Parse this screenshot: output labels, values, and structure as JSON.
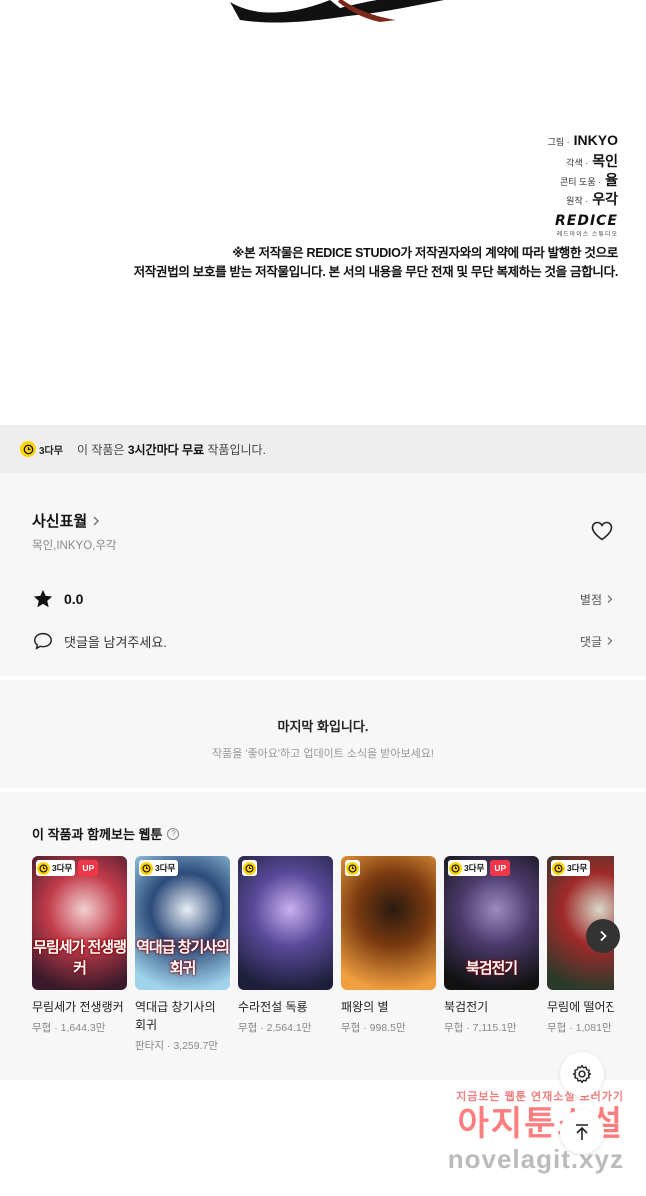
{
  "comic": {
    "credits": [
      {
        "role": "그림 ·",
        "name": "INKYO"
      },
      {
        "role": "각색 ·",
        "name": "목인"
      },
      {
        "role": "콘티 도움 ·",
        "name": "율"
      },
      {
        "role": "원작 ·",
        "name": "우각"
      }
    ],
    "logo_mark": "REDICE",
    "logo_sub": "레드아이스 스튜디오",
    "notice_line1": "※본 저작물은 REDICE STUDIO가 저작권자와의 계약에 따라 발행한 것으로",
    "notice_line2": "저작권법의 보호를 받는 저작물입니다. 본 서의 내용을 무단 전재 및 무단 복제하는 것을 금합니다."
  },
  "free_bar": {
    "badge": "3다무",
    "text_prefix": "이 작품은 ",
    "text_bold": "3시간마다 무료",
    "text_suffix": " 작품입니다."
  },
  "series": {
    "title": "사신표월",
    "authors": "목인,INKYO,우각",
    "rating": "0.0",
    "rating_link": "별점",
    "comment_prompt": "댓글을 남겨주세요.",
    "comment_link": "댓글"
  },
  "last_episode": {
    "title": "마지막 화입니다.",
    "subtitle": "작품을 '좋아요'하고 업데이트 소식을 받아보세요!"
  },
  "recommendations": {
    "title": "이 작품과 함께보는 웹툰",
    "wait_label": "3다무",
    "up_label": "UP",
    "items": [
      {
        "title": "무림세가 전생랭커",
        "genre": "무협",
        "views": "1,644.3만",
        "wait": true,
        "up": true,
        "cover_text": "무림세가 전생랭커",
        "colors": [
          "#3a1a2a",
          "#c23b4a",
          "#f2d0d0"
        ]
      },
      {
        "title": "역대급 창기사의 회귀",
        "genre": "판타지",
        "views": "3,259.7만",
        "wait": true,
        "up": false,
        "cover_text": "역대급 창기사의 회귀",
        "colors": [
          "#9fd3ea",
          "#2c4a7a",
          "#e8eef5"
        ]
      },
      {
        "title": "수라전설 독룡",
        "genre": "무협",
        "views": "2,564.1만",
        "wait": false,
        "up": false,
        "cover_text": "",
        "colors": [
          "#1d1f3a",
          "#5a4a9a",
          "#c8b0f0"
        ]
      },
      {
        "title": "패왕의 별",
        "genre": "무협",
        "views": "998.5만",
        "wait": false,
        "up": false,
        "cover_text": "",
        "colors": [
          "#f0a040",
          "#7a3a10",
          "#2a1a10"
        ]
      },
      {
        "title": "북검전기",
        "genre": "무협",
        "views": "7,115.1만",
        "wait": true,
        "up": true,
        "cover_text": "북검전기",
        "colors": [
          "#111111",
          "#4a3a6a",
          "#9a8ac0"
        ]
      },
      {
        "title": "무림에 떨어진 대인",
        "genre": "무협",
        "views": "1,081만",
        "wait": true,
        "up": false,
        "cover_text": "",
        "colors": [
          "#2a3a2a",
          "#a02a2a",
          "#d8d8c8"
        ]
      }
    ]
  },
  "watermark": {
    "line1": "지금보는 웹툰 연재소설 보러가기",
    "line2": "아지툰소설",
    "line3": "novelagit.xyz"
  }
}
